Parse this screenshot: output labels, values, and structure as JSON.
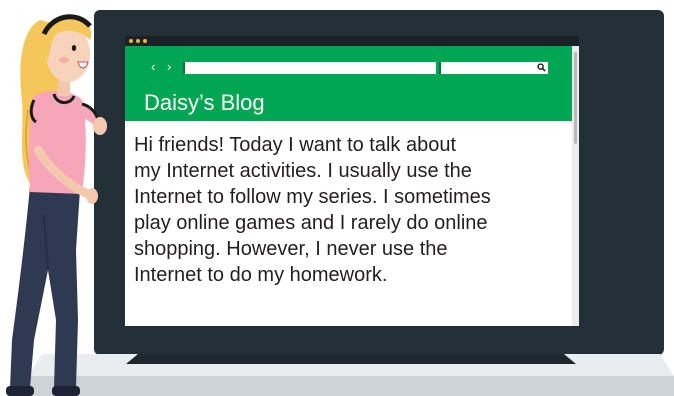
{
  "browser": {
    "nav_back_icon": "chevron-left-icon",
    "nav_forward_icon": "chevron-right-icon",
    "search_icon": "search-icon",
    "url_value": "",
    "search_value": ""
  },
  "blog": {
    "title": "Daisy’s Blog",
    "lines": [
      "Hi friends! Today I want to talk about",
      "my Internet activities. I usually use the",
      "Internet to follow my series. I sometimes",
      "play online games and I rarely do online",
      "shopping. However, I never use the",
      "Internet to do my homework."
    ]
  },
  "colors": {
    "header_green": "#00a651",
    "laptop_frame": "#243037",
    "text": "#231f20",
    "window_dots": "#f2b632"
  }
}
